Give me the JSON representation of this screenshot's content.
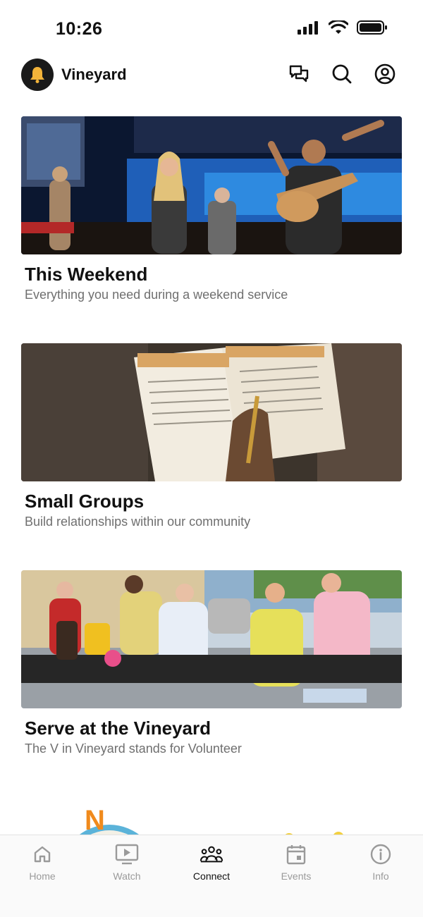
{
  "status_bar": {
    "time": "10:26"
  },
  "header": {
    "app_name": "Vineyard"
  },
  "cards": [
    {
      "title": "This Weekend",
      "subtitle": "Everything you need during a weekend service"
    },
    {
      "title": "Small Groups",
      "subtitle": "Build relationships within our community"
    },
    {
      "title": "Serve at the Vineyard",
      "subtitle": "The V in Vineyard stands for Volunteer"
    }
  ],
  "tabs": [
    {
      "label": "Home",
      "icon": "home-icon",
      "active": false
    },
    {
      "label": "Watch",
      "icon": "tv-play-icon",
      "active": false
    },
    {
      "label": "Connect",
      "icon": "people-icon",
      "active": true
    },
    {
      "label": "Events",
      "icon": "calendar-icon",
      "active": false
    },
    {
      "label": "Info",
      "icon": "info-icon",
      "active": false
    }
  ],
  "colors": {
    "logo_bg": "#1a1a1a",
    "bell": "#f3b43a",
    "active_tab": "#111111",
    "inactive_tab": "#9a9a9a"
  }
}
